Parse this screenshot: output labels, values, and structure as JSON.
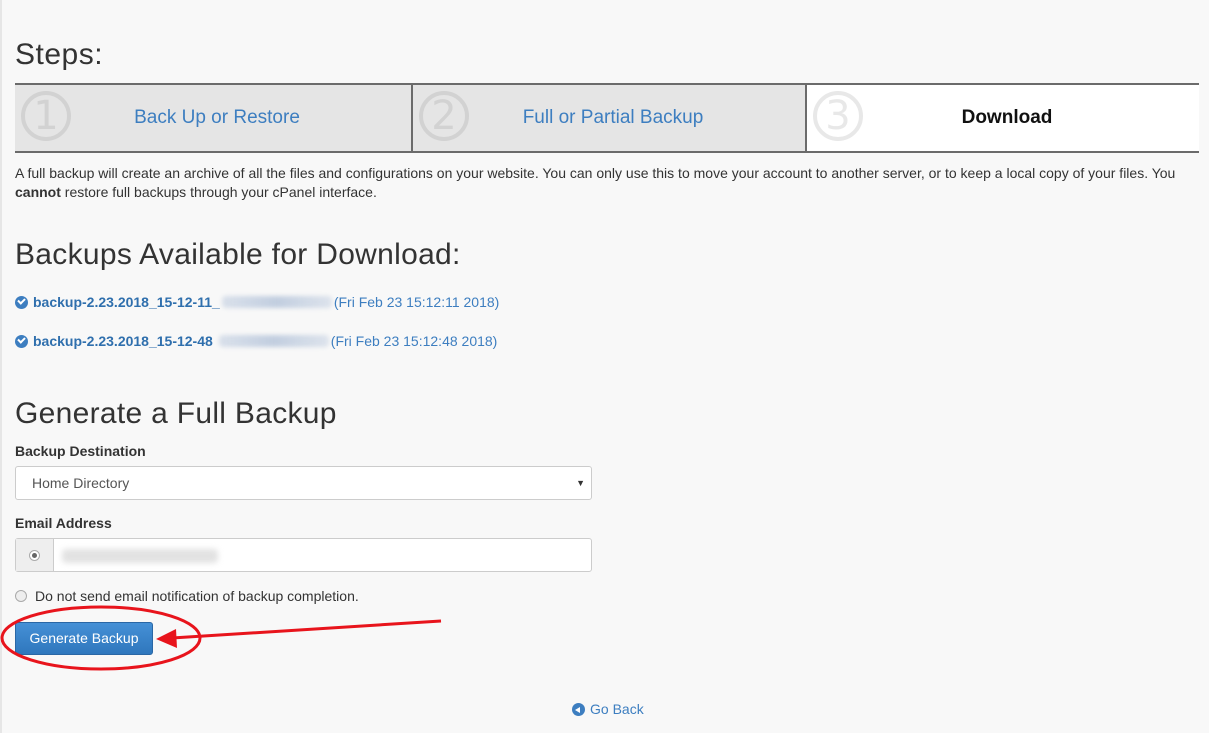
{
  "steps_title": "Steps:",
  "steps": [
    {
      "number": "1",
      "label": "Back Up or Restore",
      "state": "completed"
    },
    {
      "number": "2",
      "label": "Full or Partial Backup",
      "state": "completed"
    },
    {
      "number": "3",
      "label": "Download",
      "state": "current"
    }
  ],
  "description": {
    "part1": "A full backup will create an archive of all the files and configurations on your website. You can only use this to move your account to another server, or to keep a local copy of your files. You ",
    "bold": "cannot",
    "part2": " restore full backups through your cPanel interface."
  },
  "available": {
    "title": "Backups Available for Download:",
    "items": [
      {
        "name": "backup-2.23.2018_15-12-11_",
        "date": "(Fri Feb 23 15:12:11 2018)"
      },
      {
        "name": "backup-2.23.2018_15-12-48",
        "date": "(Fri Feb 23 15:12:48 2018)"
      }
    ]
  },
  "generate": {
    "title": "Generate a Full Backup",
    "destination_label": "Backup Destination",
    "destination_value": "Home Directory",
    "email_label": "Email Address",
    "no_email_label": "Do not send email notification of backup completion.",
    "button_label": "Generate Backup"
  },
  "go_back": "Go Back",
  "colors": {
    "link": "#3d7ec0",
    "button": "#337ab7",
    "annotation": "#e8141c"
  }
}
